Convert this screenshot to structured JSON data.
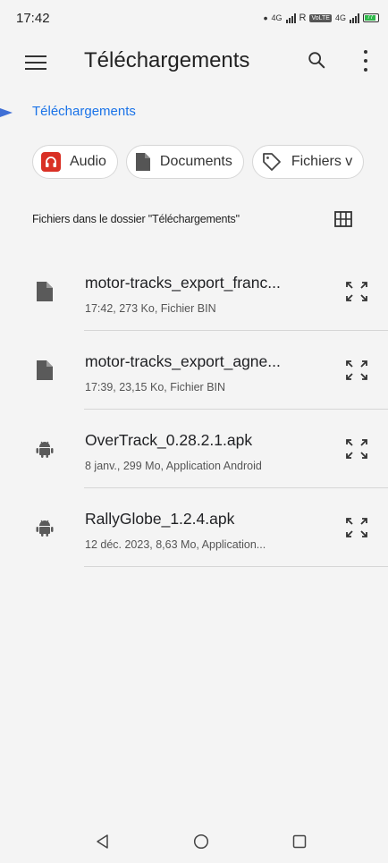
{
  "status_bar": {
    "time": "17:42",
    "signal_label_1": "4G",
    "roaming": "R",
    "volte": "VoLTE",
    "signal_label_2": "4G",
    "battery": "77"
  },
  "app_bar": {
    "title": "Téléchargements"
  },
  "breadcrumb": "Téléchargements",
  "chips": [
    {
      "label": "Audio",
      "icon": "headphones-icon"
    },
    {
      "label": "Documents",
      "icon": "document-icon"
    },
    {
      "label": "Fichiers v",
      "icon": "tag-icon"
    }
  ],
  "section_header": "Fichiers dans le dossier \"Téléchargements\"",
  "files": [
    {
      "name": "motor-tracks_export_franc...",
      "meta": "17:42, 273 Ko, Fichier BIN",
      "icon": "file-icon"
    },
    {
      "name": "motor-tracks_export_agne...",
      "meta": "17:39, 23,15 Ko, Fichier BIN",
      "icon": "file-icon"
    },
    {
      "name": "OverTrack_0.28.2.1.apk",
      "meta": "8 janv., 299 Mo, Application Android",
      "icon": "android-icon"
    },
    {
      "name": "RallyGlobe_1.2.4.apk",
      "meta": "12 déc. 2023, 8,63 Mo, Application...",
      "icon": "android-icon"
    }
  ],
  "colors": {
    "accent": "#1a73e8",
    "background": "#f4f4f4",
    "audio_chip": "#d93025"
  }
}
